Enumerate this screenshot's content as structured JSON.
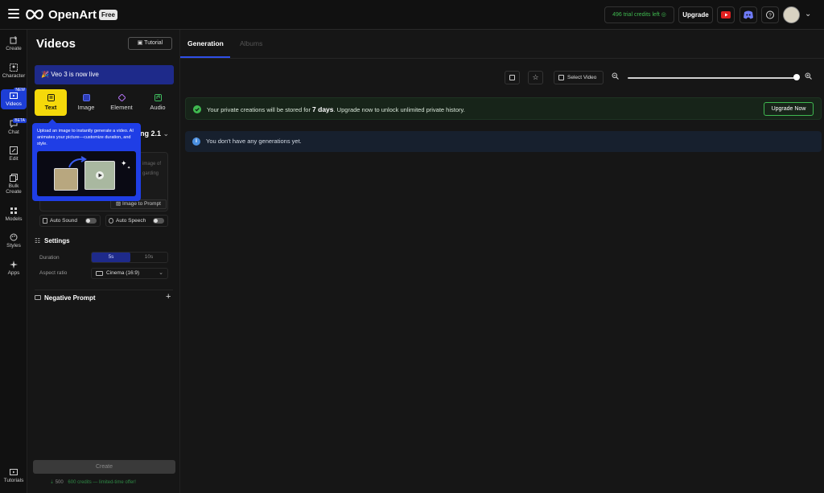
{
  "topbar": {
    "brand": "OpenArt",
    "plan_badge": "Free",
    "credits": "496 trial credits left",
    "upgrade_label": "Upgrade"
  },
  "rail": {
    "items": [
      {
        "label": "Create",
        "icon": "create-icon"
      },
      {
        "label": "Character",
        "icon": "character-icon"
      },
      {
        "label": "Videos",
        "icon": "videos-icon",
        "badge": "NEW",
        "active": true
      },
      {
        "label": "Chat",
        "icon": "chat-icon",
        "badge": "BETA"
      },
      {
        "label": "Edit",
        "icon": "edit-icon"
      },
      {
        "label": "Bulk Create",
        "icon": "bulk-create-icon"
      },
      {
        "label": "Models",
        "icon": "models-icon"
      },
      {
        "label": "Styles",
        "icon": "styles-icon"
      },
      {
        "label": "Apps",
        "icon": "apps-icon"
      }
    ],
    "footer": {
      "label": "Tutorials",
      "icon": "tutorials-icon"
    }
  },
  "panel": {
    "title": "Videos",
    "tutorial_label": "Tutorial",
    "banner": "Veo 3 is now live",
    "tabs": [
      {
        "label": "Text",
        "active": true
      },
      {
        "label": "Image"
      },
      {
        "label": "Element"
      },
      {
        "label": "Audio"
      }
    ],
    "model_visible": "ng 2.1",
    "prompt_snippet_1": "image of",
    "prompt_snippet_2": "garding",
    "image_to_prompt": "Image to Prompt",
    "auto_sound": "Auto Sound",
    "auto_speech": "Auto Speech",
    "settings_title": "Settings",
    "duration_label": "Duration",
    "duration_options": [
      "5s",
      "10s"
    ],
    "duration_selected": "5s",
    "aspect_label": "Aspect ratio",
    "aspect_value": "Cinema (16:9)",
    "negative_prompt": "Negative Prompt",
    "create_label": "Create",
    "credits_old": "500",
    "credits_note": "600 credits — limited-time offer!"
  },
  "tooltip": {
    "text": "Upload an image to instantly generate a video. AI animates your picture—customize duration, and style."
  },
  "main": {
    "tabs": [
      {
        "label": "Generation",
        "active": true
      },
      {
        "label": "Albums"
      }
    ],
    "select_video": "Select Video",
    "zoom_level": 1.0,
    "private_text_pre": "Your private creations will be stored for ",
    "private_text_bold": "7 days",
    "private_text_post": ". Upgrade now to unlock unlimited private history.",
    "upgrade_now": "Upgrade Now",
    "empty_text": "You don't have any generations yet."
  },
  "colors": {
    "accent": "#1f3ee6",
    "active_tab": "#f5d90a",
    "success": "#3fb950",
    "info": "#4a8fe0"
  }
}
